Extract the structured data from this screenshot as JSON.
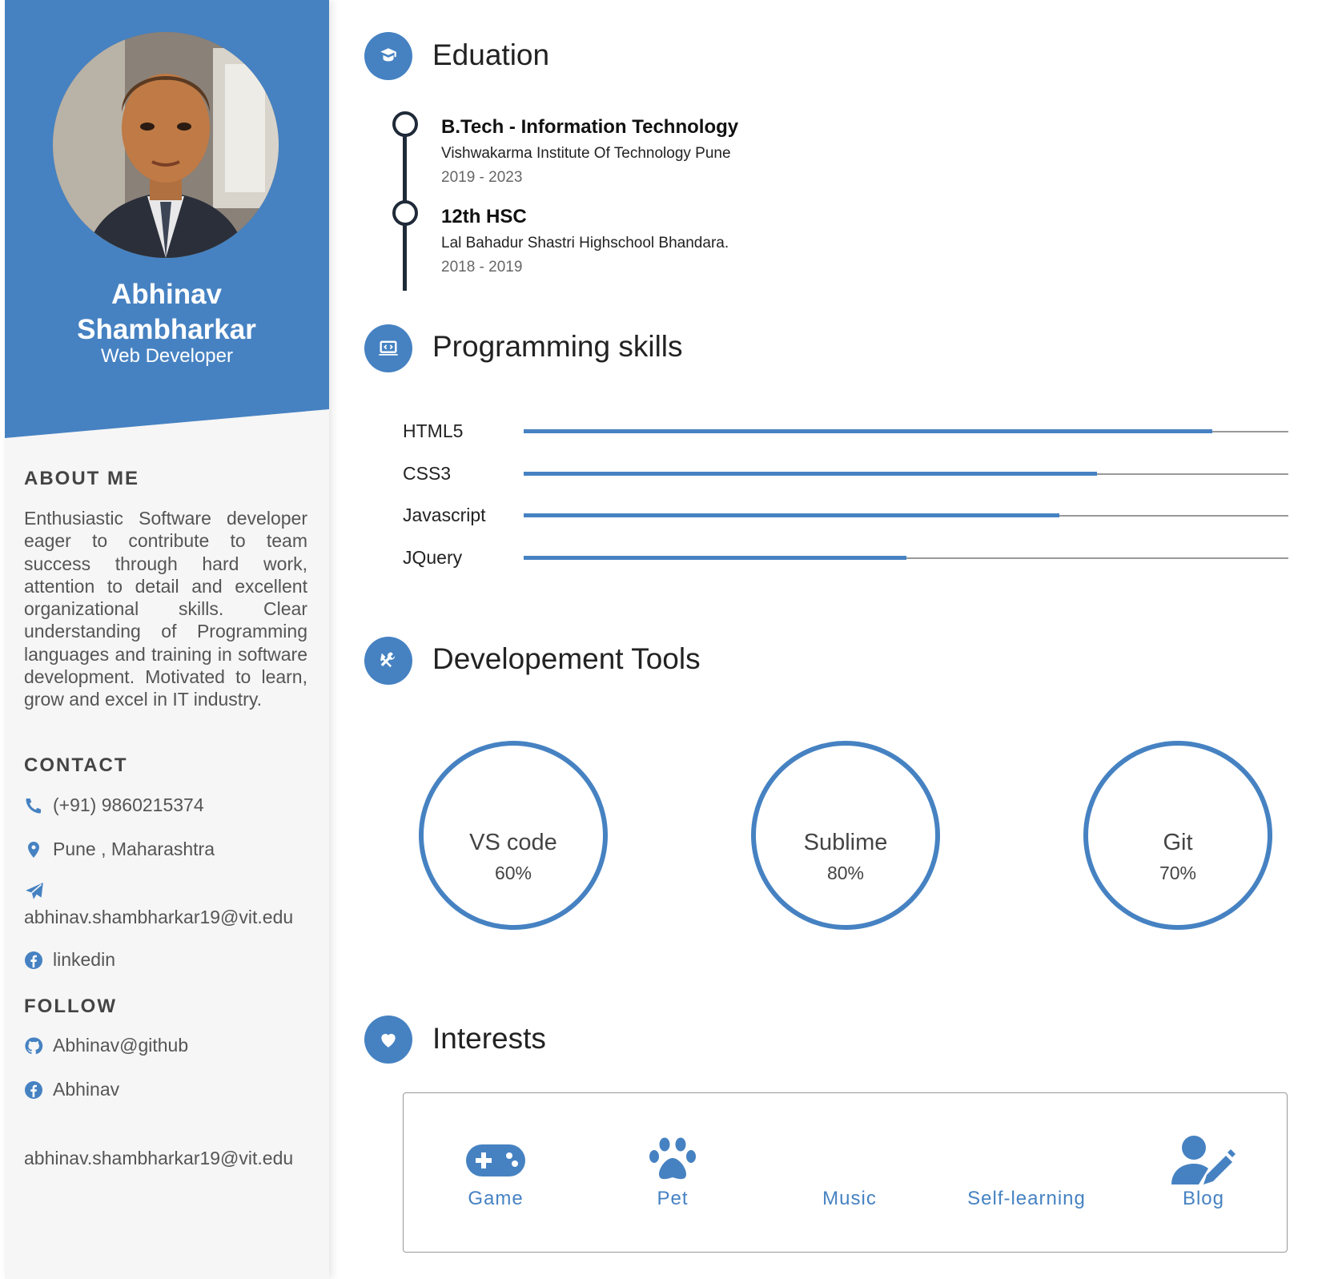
{
  "profile": {
    "name": "Abhinav Shambharkar",
    "role": "Web Developer"
  },
  "about": {
    "heading": "ABOUT ME",
    "text": "Enthusiastic Software developer eager to contribute to team success through hard work, attention to detail and excellent organizational skills. Clear understanding of Programming languages and training in software development. Motivated to learn, grow and excel in IT industry."
  },
  "contact": {
    "heading": "CONTACT",
    "phone": "(+91) 9860215374",
    "location": "Pune , Maharashtra",
    "email": "abhinav.shambharkar19@vit.edu",
    "linkedin": "linkedin"
  },
  "follow": {
    "heading": "FOLLOW",
    "github": "Abhinav@github",
    "facebook": "Abhinav",
    "email": "abhinav.shambharkar19@vit.edu"
  },
  "education": {
    "title": "Eduation",
    "items": [
      {
        "degree": "B.Tech - Information Technology",
        "school": "Vishwakarma Institute Of Technology Pune",
        "years": "2019 - 2023"
      },
      {
        "degree": "12th HSC",
        "school": "Lal Bahadur Shastri Highschool Bhandara.",
        "years": "2018 - 2019"
      }
    ]
  },
  "skills": {
    "title": "Programming skills",
    "items": [
      {
        "name": "HTML5",
        "level": 0.9
      },
      {
        "name": "CSS3",
        "level": 0.75
      },
      {
        "name": "Javascript",
        "level": 0.7
      },
      {
        "name": "JQuery",
        "level": 0.5
      }
    ]
  },
  "tools": {
    "title": "Developement Tools",
    "items": [
      {
        "name": "VS code",
        "percent": "60%"
      },
      {
        "name": "Sublime",
        "percent": "80%"
      },
      {
        "name": "Git",
        "percent": "70%"
      }
    ]
  },
  "interests": {
    "title": "Interests",
    "items": [
      {
        "label": "Game",
        "icon": "gamepad-icon"
      },
      {
        "label": "Pet",
        "icon": "paw-icon"
      },
      {
        "label": "Music",
        "icon": ""
      },
      {
        "label": "Self-learning",
        "icon": ""
      },
      {
        "label": "Blog",
        "icon": "user-edit-icon"
      }
    ]
  },
  "colors": {
    "accent": "#4682c2",
    "timeline": "#1f2a38",
    "sidebar_bg": "#f6f6f6"
  }
}
